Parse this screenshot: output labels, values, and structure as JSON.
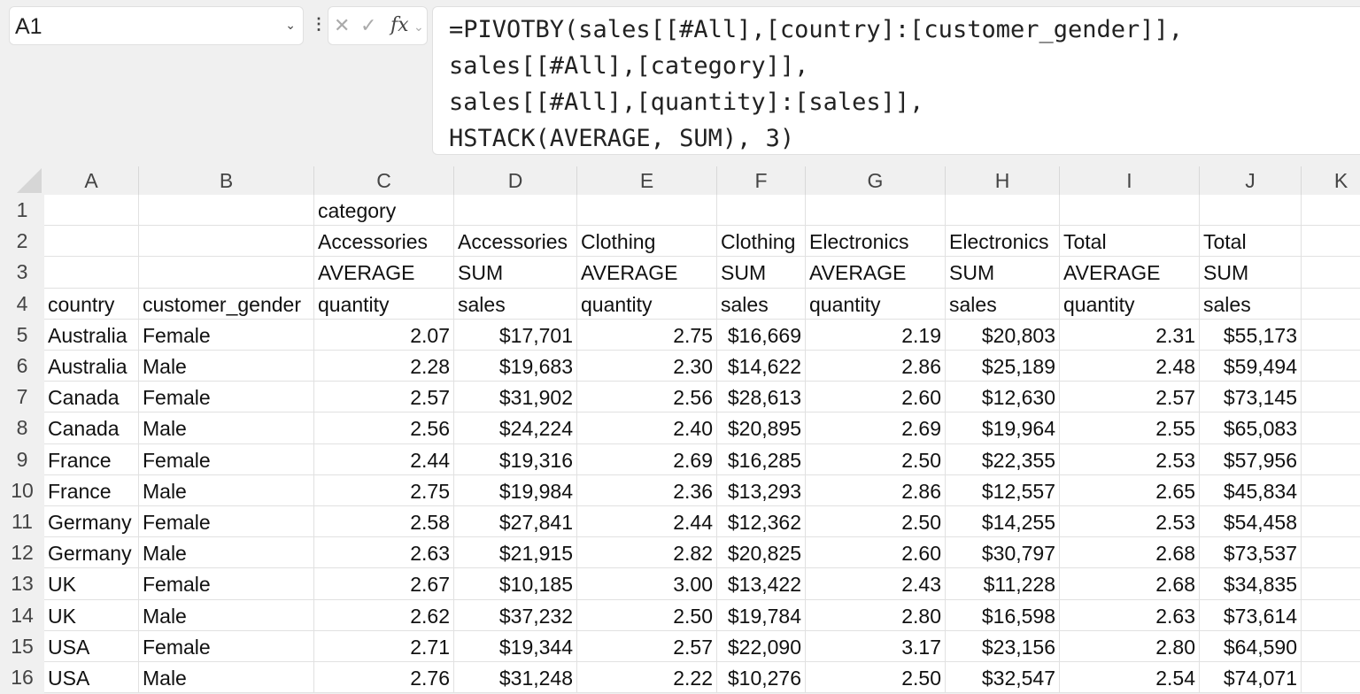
{
  "name_box": "A1",
  "formula_lines": [
    "=PIVOTBY(sales[[#All],[country]:[customer_gender]],",
    "sales[[#All],[category]],",
    "sales[[#All],[quantity]:[sales]],",
    "HSTACK(AVERAGE, SUM), 3)"
  ],
  "columns": [
    "A",
    "B",
    "C",
    "D",
    "E",
    "F",
    "G",
    "H",
    "I",
    "J",
    "K"
  ],
  "rows": [
    [
      "",
      "",
      "category",
      "",
      "",
      "",
      "",
      "",
      "",
      ""
    ],
    [
      "",
      "",
      "Accessories",
      "Accessories",
      "Clothing",
      "Clothing",
      "Electronics",
      "Electronics",
      "Total",
      "Total"
    ],
    [
      "",
      "",
      "AVERAGE",
      "SUM",
      "AVERAGE",
      "SUM",
      "AVERAGE",
      "SUM",
      "AVERAGE",
      "SUM"
    ],
    [
      "country",
      "customer_gender",
      "quantity",
      "sales",
      "quantity",
      "sales",
      "quantity",
      "sales",
      "quantity",
      "sales"
    ],
    [
      "Australia",
      "Female",
      "2.07",
      "$17,701",
      "2.75",
      "$16,669",
      "2.19",
      "$20,803",
      "2.31",
      "$55,173"
    ],
    [
      "Australia",
      "Male",
      "2.28",
      "$19,683",
      "2.30",
      "$14,622",
      "2.86",
      "$25,189",
      "2.48",
      "$59,494"
    ],
    [
      "Canada",
      "Female",
      "2.57",
      "$31,902",
      "2.56",
      "$28,613",
      "2.60",
      "$12,630",
      "2.57",
      "$73,145"
    ],
    [
      "Canada",
      "Male",
      "2.56",
      "$24,224",
      "2.40",
      "$20,895",
      "2.69",
      "$19,964",
      "2.55",
      "$65,083"
    ],
    [
      "France",
      "Female",
      "2.44",
      "$19,316",
      "2.69",
      "$16,285",
      "2.50",
      "$22,355",
      "2.53",
      "$57,956"
    ],
    [
      "France",
      "Male",
      "2.75",
      "$19,984",
      "2.36",
      "$13,293",
      "2.86",
      "$12,557",
      "2.65",
      "$45,834"
    ],
    [
      "Germany",
      "Female",
      "2.58",
      "$27,841",
      "2.44",
      "$12,362",
      "2.50",
      "$14,255",
      "2.53",
      "$54,458"
    ],
    [
      "Germany",
      "Male",
      "2.63",
      "$21,915",
      "2.82",
      "$20,825",
      "2.60",
      "$30,797",
      "2.68",
      "$73,537"
    ],
    [
      "UK",
      "Female",
      "2.67",
      "$10,185",
      "3.00",
      "$13,422",
      "2.43",
      "$11,228",
      "2.68",
      "$34,835"
    ],
    [
      "UK",
      "Male",
      "2.62",
      "$37,232",
      "2.50",
      "$19,784",
      "2.80",
      "$16,598",
      "2.63",
      "$73,614"
    ],
    [
      "USA",
      "Female",
      "2.71",
      "$19,344",
      "2.57",
      "$22,090",
      "3.17",
      "$23,156",
      "2.80",
      "$64,590"
    ],
    [
      "USA",
      "Male",
      "2.76",
      "$31,248",
      "2.22",
      "$10,276",
      "2.50",
      "$32,547",
      "2.54",
      "$74,071"
    ]
  ]
}
